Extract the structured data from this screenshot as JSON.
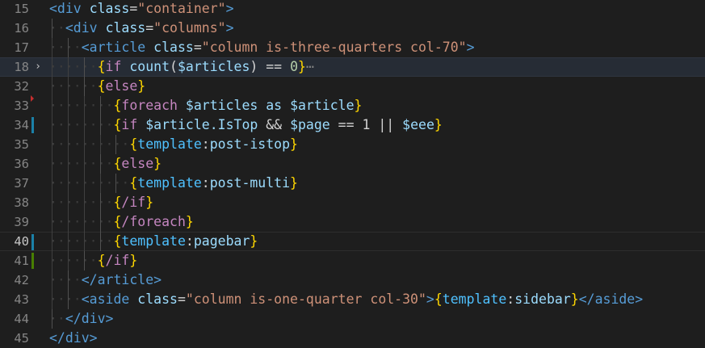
{
  "editor": {
    "lines": [
      {
        "num": "15",
        "indent": 0,
        "diff": "",
        "tokens": [
          [
            "tag",
            "<div"
          ],
          [
            "text",
            " "
          ],
          [
            "attr",
            "class"
          ],
          [
            "eq",
            "="
          ],
          [
            "str",
            "\"container\""
          ],
          [
            "tag",
            ">"
          ]
        ]
      },
      {
        "num": "16",
        "indent": 1,
        "diff": "",
        "tokens": [
          [
            "tag",
            "<div"
          ],
          [
            "text",
            " "
          ],
          [
            "attr",
            "class"
          ],
          [
            "eq",
            "="
          ],
          [
            "str",
            "\"columns\""
          ],
          [
            "tag",
            ">"
          ]
        ]
      },
      {
        "num": "17",
        "indent": 2,
        "diff": "",
        "tokens": [
          [
            "tag",
            "<article"
          ],
          [
            "text",
            " "
          ],
          [
            "attr",
            "class"
          ],
          [
            "eq",
            "="
          ],
          [
            "str",
            "\"column is-three-quarters col-70\""
          ],
          [
            "tag",
            ">"
          ]
        ]
      },
      {
        "num": "18",
        "indent": 3,
        "diff": "",
        "fold": "›",
        "current": true,
        "tokens": [
          [
            "brace",
            "{"
          ],
          [
            "kw",
            "if"
          ],
          [
            "text",
            " "
          ],
          [
            "name",
            "count"
          ],
          [
            "op",
            "("
          ],
          [
            "var",
            "$articles"
          ],
          [
            "op",
            ")"
          ],
          [
            "text",
            " "
          ],
          [
            "op",
            "=="
          ],
          [
            "text",
            " "
          ],
          [
            "num",
            "0"
          ],
          [
            "brace",
            "}"
          ],
          [
            "dots",
            "⋯"
          ]
        ]
      },
      {
        "num": "32",
        "indent": 3,
        "diff": "",
        "tokens": [
          [
            "brace",
            "{"
          ],
          [
            "kw",
            "else"
          ],
          [
            "brace",
            "}"
          ]
        ]
      },
      {
        "num": "33",
        "indent": 4,
        "diff": "del",
        "tokens": [
          [
            "brace",
            "{"
          ],
          [
            "kw",
            "foreach"
          ],
          [
            "text",
            " "
          ],
          [
            "var",
            "$articles"
          ],
          [
            "text",
            " "
          ],
          [
            "name",
            "as"
          ],
          [
            "text",
            " "
          ],
          [
            "var",
            "$article"
          ],
          [
            "brace",
            "}"
          ]
        ]
      },
      {
        "num": "34",
        "indent": 4,
        "diff": "mod",
        "tokens": [
          [
            "brace",
            "{"
          ],
          [
            "kw",
            "if"
          ],
          [
            "text",
            " "
          ],
          [
            "var",
            "$article.IsTop"
          ],
          [
            "text",
            " "
          ],
          [
            "op",
            "&&"
          ],
          [
            "text",
            " "
          ],
          [
            "var",
            "$page"
          ],
          [
            "text",
            " "
          ],
          [
            "op",
            "=="
          ],
          [
            "text",
            " "
          ],
          [
            "op",
            "1"
          ],
          [
            "text",
            " "
          ],
          [
            "op",
            "||"
          ],
          [
            "text",
            " "
          ],
          [
            "var",
            "$eee"
          ],
          [
            "brace",
            "}"
          ]
        ]
      },
      {
        "num": "35",
        "indent": 5,
        "diff": "",
        "tokens": [
          [
            "brace",
            "{"
          ],
          [
            "tpl",
            "template"
          ],
          [
            "op",
            ":"
          ],
          [
            "name",
            "post-istop"
          ],
          [
            "brace",
            "}"
          ]
        ]
      },
      {
        "num": "36",
        "indent": 4,
        "diff": "",
        "tokens": [
          [
            "brace",
            "{"
          ],
          [
            "kw",
            "else"
          ],
          [
            "brace",
            "}"
          ]
        ]
      },
      {
        "num": "37",
        "indent": 5,
        "diff": "",
        "tokens": [
          [
            "brace",
            "{"
          ],
          [
            "tpl",
            "template"
          ],
          [
            "op",
            ":"
          ],
          [
            "name",
            "post-multi"
          ],
          [
            "brace",
            "}"
          ]
        ]
      },
      {
        "num": "38",
        "indent": 4,
        "diff": "",
        "tokens": [
          [
            "brace",
            "{"
          ],
          [
            "kw",
            "/if"
          ],
          [
            "brace",
            "}"
          ]
        ]
      },
      {
        "num": "39",
        "indent": 4,
        "diff": "",
        "tokens": [
          [
            "brace",
            "{"
          ],
          [
            "kw",
            "/foreach"
          ],
          [
            "brace",
            "}"
          ]
        ]
      },
      {
        "num": "40",
        "indent": 4,
        "diff": "mod",
        "active": true,
        "tokens": [
          [
            "brace",
            "{"
          ],
          [
            "tpl",
            "template"
          ],
          [
            "op",
            ":"
          ],
          [
            "name",
            "pagebar"
          ],
          [
            "brace",
            "}"
          ]
        ]
      },
      {
        "num": "41",
        "indent": 3,
        "diff": "add",
        "tokens": [
          [
            "brace",
            "{"
          ],
          [
            "kw",
            "/if"
          ],
          [
            "brace",
            "}"
          ]
        ]
      },
      {
        "num": "42",
        "indent": 2,
        "diff": "",
        "tokens": [
          [
            "tag",
            "</article"
          ],
          [
            "tag",
            ">"
          ]
        ]
      },
      {
        "num": "43",
        "indent": 2,
        "diff": "",
        "tokens": [
          [
            "tag",
            "<aside"
          ],
          [
            "text",
            " "
          ],
          [
            "attr",
            "class"
          ],
          [
            "eq",
            "="
          ],
          [
            "str",
            "\"column is-one-quarter col-30\""
          ],
          [
            "tag",
            ">"
          ],
          [
            "brace",
            "{"
          ],
          [
            "tpl",
            "template"
          ],
          [
            "op",
            ":"
          ],
          [
            "name",
            "sidebar"
          ],
          [
            "brace",
            "}"
          ],
          [
            "tag",
            "</aside"
          ],
          [
            "tag",
            ">"
          ]
        ]
      },
      {
        "num": "44",
        "indent": 1,
        "diff": "",
        "tokens": [
          [
            "tag",
            "</div"
          ],
          [
            "tag",
            ">"
          ]
        ]
      },
      {
        "num": "45",
        "indent": 0,
        "diff": "",
        "tokens": [
          [
            "tag",
            "</div"
          ],
          [
            "tag",
            ">"
          ]
        ]
      }
    ]
  }
}
